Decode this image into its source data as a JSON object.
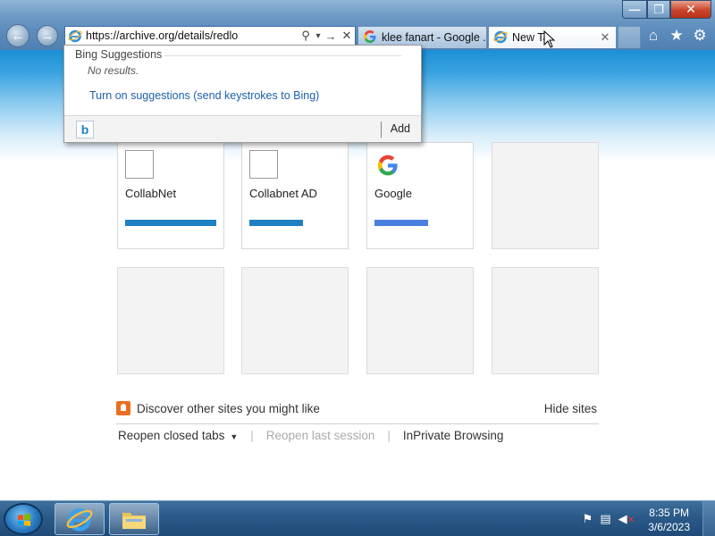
{
  "window": {
    "min_glyph": "—",
    "max_glyph": "❐",
    "close_glyph": "✕"
  },
  "nav": {
    "back_glyph": "←",
    "forward_glyph": "→"
  },
  "address": {
    "url": "https://archive.org/details/redlo",
    "search_glyph": "⚲",
    "dropdown_glyph": "▾",
    "go_glyph": "→",
    "stop_glyph": "✕"
  },
  "tabs": [
    {
      "title": "klee fanart - Google ...",
      "icon": "google-g-icon"
    },
    {
      "title": "New Ta",
      "icon": "ie-icon",
      "close_glyph": "✕"
    }
  ],
  "toolbar": {
    "home_glyph": "⌂",
    "favorites_glyph": "★",
    "settings_glyph": "⚙"
  },
  "suggestions": {
    "header": "Bing Suggestions",
    "no_results": "No results.",
    "turn_on": "Turn on suggestions (send keystrokes to Bing)",
    "bing_glyph": "b",
    "add_label": "Add"
  },
  "tiles": [
    {
      "label": "CollabNet",
      "bar_color": "#1e7fc2",
      "icon": "blank"
    },
    {
      "label": "Collabnet AD",
      "bar_color": "#1e7fc2",
      "icon": "blank"
    },
    {
      "label": "Google",
      "bar_color": "#4a7fe0",
      "icon": "google-g-icon"
    }
  ],
  "discover": {
    "text": "Discover other sites you might like",
    "hide": "Hide sites"
  },
  "links": {
    "reopen_tabs": "Reopen closed tabs",
    "reopen_session": "Reopen last session",
    "inprivate": "InPrivate Browsing"
  },
  "taskbar": {
    "time": "8:35 PM",
    "date": "3/6/2023"
  }
}
